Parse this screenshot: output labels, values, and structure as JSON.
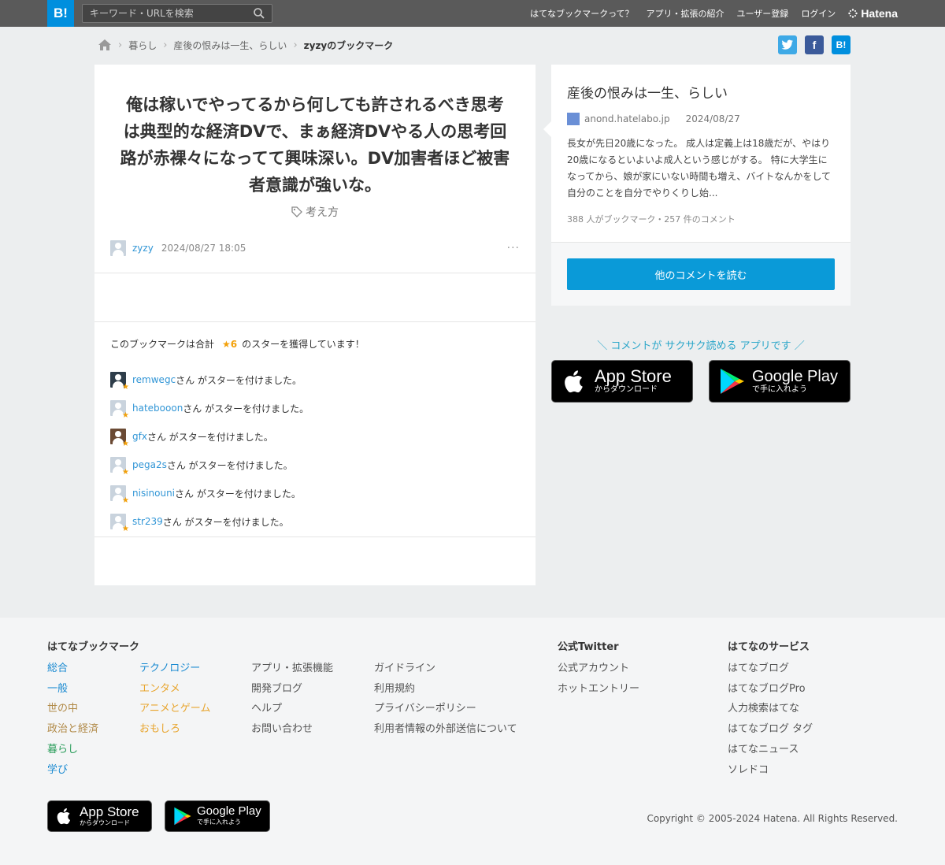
{
  "header": {
    "logo": "B!",
    "search_placeholder": "キーワード・URLを検索",
    "nav": [
      "はてなブックマークって？",
      "アプリ・拡張の紹介",
      "ユーザー登録",
      "ログイン"
    ],
    "brand": "Hatena"
  },
  "breadcrumb": {
    "items": [
      "暮らし",
      "産後の恨みは一生、らしい",
      "zyzyのブックマーク"
    ]
  },
  "share": {
    "twitter": "t",
    "facebook": "f",
    "hatena": "B!"
  },
  "bookmark": {
    "comment": "俺は稼いでやってるから何しても許されるべき思考は典型的な経済DVで、まぁ経済DVやる人の思考回路が赤裸々になってて興味深い。DV加害者ほど被害者意識が強いな。",
    "tag": "考え方",
    "user": "zyzy",
    "date": "2024/08/27 18:05",
    "more": "···"
  },
  "stars": {
    "summary_prefix": "このブックマークは合計",
    "summary_count": "★6",
    "summary_suffix": "のスターを獲得しています！",
    "action_text": "さん がスターを付けました。",
    "users": [
      "remwegc",
      "hatebooon",
      "gfx",
      "pega2s",
      "nisinouni",
      "str239"
    ]
  },
  "entry": {
    "title": "産後の恨みは一生、らしい",
    "domain": "anond.hatelabo.jp",
    "date": "2024/08/27",
    "excerpt": "長女が先日20歳になった。 成人は定義上は18歳だが、やはり20歳になるといよいよ成人という感じがする。 特に大学生になってから、娘が家にいない時間も増え、バイトなんかをして自分のことを自分でやりくりし始...",
    "counts": "388 人がブックマーク・257 件のコメント",
    "read_button": "他のコメントを読む"
  },
  "app_promo": {
    "text": "＼ コメントが サクサク読める アプリです ／",
    "appstore_big": "App Store",
    "appstore_small": "からダウンロード",
    "googleplay_big": "Google Play",
    "googleplay_small": "で手に入れよう"
  },
  "footer": {
    "hb_title": "はてなブックマーク",
    "categories_col1": [
      "総合",
      "一般",
      "世の中",
      "政治と経済",
      "暮らし",
      "学び"
    ],
    "categories_col2": [
      "テクノロジー",
      "エンタメ",
      "アニメとゲーム",
      "おもしろ"
    ],
    "links_col3": [
      "アプリ・拡張機能",
      "開発ブログ",
      "ヘルプ",
      "お問い合わせ"
    ],
    "links_col4": [
      "ガイドライン",
      "利用規約",
      "プライバシーポリシー",
      "利用者情報の外部送信について"
    ],
    "twitter_title": "公式Twitter",
    "twitter_links": [
      "公式アカウント",
      "ホットエントリー"
    ],
    "services_title": "はてなのサービス",
    "services": [
      "はてなブログ",
      "はてなブログPro",
      "人力検索はてな",
      "はてなブログ タグ",
      "はてなニュース",
      "ソレドコ"
    ],
    "appstore_big": "App Store",
    "appstore_small": "からダウンロード",
    "googleplay_big": "Google Play",
    "googleplay_small": "で手に入れよう",
    "copyright": "Copyright © 2005-2024 Hatena. All Rights Reserved."
  },
  "colors": {
    "accent": "#008fde",
    "button": "#0a9ad8",
    "star": "#f3a10a",
    "link": "#3296d6"
  }
}
